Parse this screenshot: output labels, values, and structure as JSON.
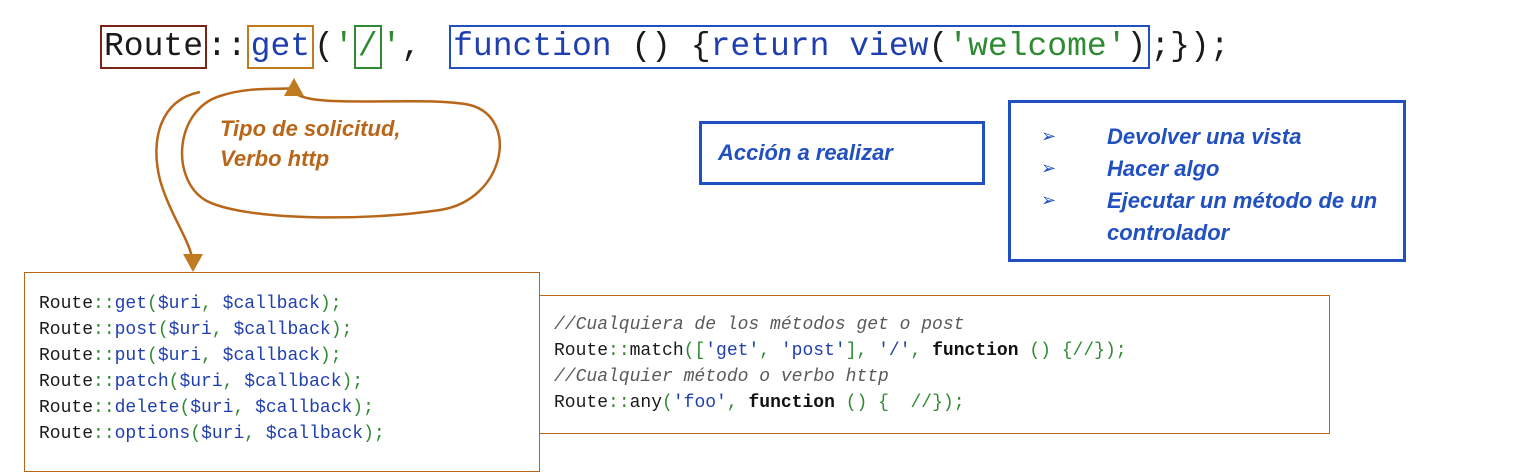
{
  "main_line": {
    "route": "Route",
    "sep": "::",
    "method": "get",
    "paren_open": "(",
    "quote1": "'",
    "uri": "/",
    "quote2": "'",
    "comma": ",",
    "func_keyword": "function",
    "func_parens": " () {",
    "return_kw": "return",
    "view_fn": "view",
    "view_open": "(",
    "view_arg": "'welcome'",
    "view_close": ")",
    "end": ";});"
  },
  "labels": {
    "tipo_line1": "Tipo de solicitud,",
    "tipo_line2": "Verbo http",
    "accion": "Acción a realizar"
  },
  "options": {
    "arrow": "➢",
    "items": [
      "Devolver una vista",
      "Hacer algo",
      "Ejecutar un método de un controlador"
    ]
  },
  "routes": [
    {
      "cls": "Route",
      "sep": "::",
      "method": "get",
      "open": "(",
      "arg1": "$uri",
      "comma": ", ",
      "arg2": "$callback",
      "close": ");"
    },
    {
      "cls": "Route",
      "sep": "::",
      "method": "post",
      "open": "(",
      "arg1": "$uri",
      "comma": ", ",
      "arg2": "$callback",
      "close": ");"
    },
    {
      "cls": "Route",
      "sep": "::",
      "method": "put",
      "open": "(",
      "arg1": "$uri",
      "comma": ", ",
      "arg2": "$callback",
      "close": ");"
    },
    {
      "cls": "Route",
      "sep": "::",
      "method": "patch",
      "open": "(",
      "arg1": "$uri",
      "comma": ", ",
      "arg2": "$callback",
      "close": ");"
    },
    {
      "cls": "Route",
      "sep": "::",
      "method": "delete",
      "open": "(",
      "arg1": "$uri",
      "comma": ", ",
      "arg2": "$callback",
      "close": ");"
    },
    {
      "cls": "Route",
      "sep": "::",
      "method": "options",
      "open": "(",
      "arg1": "$uri",
      "comma": ", ",
      "arg2": "$callback",
      "close": ");"
    }
  ],
  "match_box": {
    "comment1": "//Cualquiera de los métodos get o post",
    "l2_route": "Route",
    "l2_sep": "::",
    "l2_method": "match",
    "l2_open": "([",
    "l2_get": "'get'",
    "l2_c1": ", ",
    "l2_post": "'post'",
    "l2_close": "], ",
    "l2_uri": "'/'",
    "l2_c2": ", ",
    "l2_kw": "function",
    "l2_tail": " () {//});",
    "comment2": "//Cualquier método o verbo http",
    "l4_route": "Route",
    "l4_sep": "::",
    "l4_method": "any",
    "l4_open": "(",
    "l4_foo": "'foo'",
    "l4_c": ", ",
    "l4_kw": "function",
    "l4_tail": " () {  //});"
  },
  "colors": {
    "route_box": "#7a2418",
    "get_box": "#c07a20",
    "uri_box": "#2f8a33",
    "function_box": "#2150c0",
    "annotation_orange": "#b8671a",
    "annotation_blue": "#2150c0"
  }
}
